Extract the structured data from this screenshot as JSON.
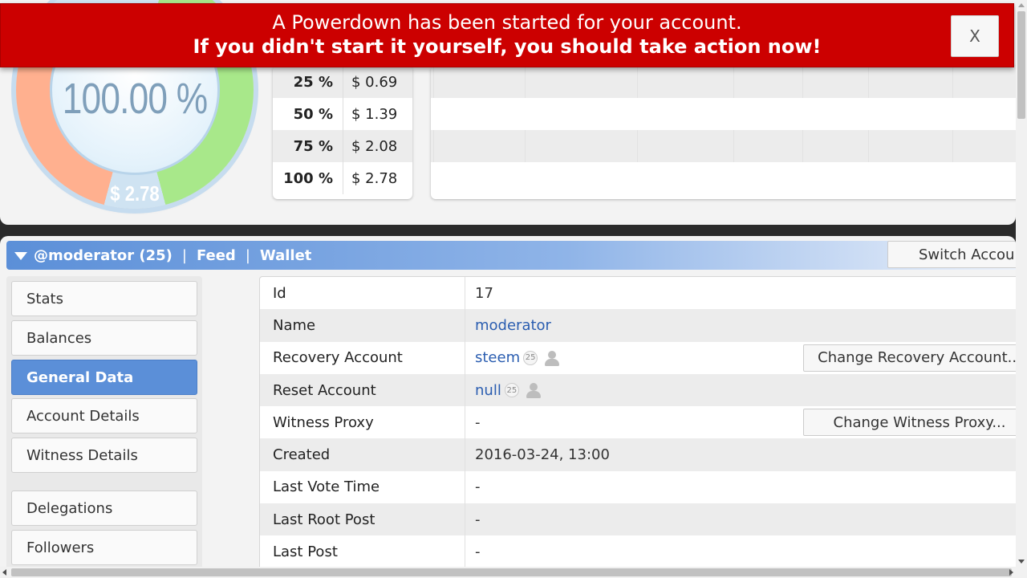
{
  "banner": {
    "line1": "A Powerdown has been started for your account.",
    "line2": "If you didn't start it yourself, you should take action now!",
    "close_label": "X"
  },
  "gauge": {
    "percent": "100.00 %",
    "value": "$ 2.78"
  },
  "vote_values": [
    {
      "pct": "25 %",
      "value": "$ 0.69"
    },
    {
      "pct": "50 %",
      "value": "$ 1.39"
    },
    {
      "pct": "75 %",
      "value": "$ 2.08"
    },
    {
      "pct": "100 %",
      "value": "$ 2.78"
    }
  ],
  "account_bar": {
    "account": "@moderator (25)",
    "sep": "|",
    "feed": "Feed",
    "wallet": "Wallet",
    "switch_label": "Switch Account"
  },
  "sidebar": {
    "items": [
      {
        "label": "Stats",
        "active": false
      },
      {
        "label": "Balances",
        "active": false
      },
      {
        "label": "General Data",
        "active": true
      },
      {
        "label": "Account Details",
        "active": false
      },
      {
        "label": "Witness Details",
        "active": false
      },
      {
        "label": "Delegations",
        "active": false
      },
      {
        "label": "Followers",
        "active": false
      }
    ]
  },
  "general_data": {
    "rows": [
      {
        "key": "Id",
        "value": "17"
      },
      {
        "key": "Name",
        "value": "moderator"
      },
      {
        "key": "Recovery Account",
        "value": "steem",
        "rep": "25",
        "button": "Change Recovery Account..."
      },
      {
        "key": "Reset Account",
        "value": "null",
        "rep": "25"
      },
      {
        "key": "Witness Proxy",
        "value": "-",
        "button": "Change Witness Proxy..."
      },
      {
        "key": "Created",
        "value": "2016-03-24, 13:00"
      },
      {
        "key": "Last Vote Time",
        "value": "-"
      },
      {
        "key": "Last Root Post",
        "value": "-"
      },
      {
        "key": "Last Post",
        "value": "-"
      }
    ]
  },
  "colors": {
    "banner": "#cc0000",
    "accent": "#5b8fd8",
    "link": "#2a5db0"
  }
}
